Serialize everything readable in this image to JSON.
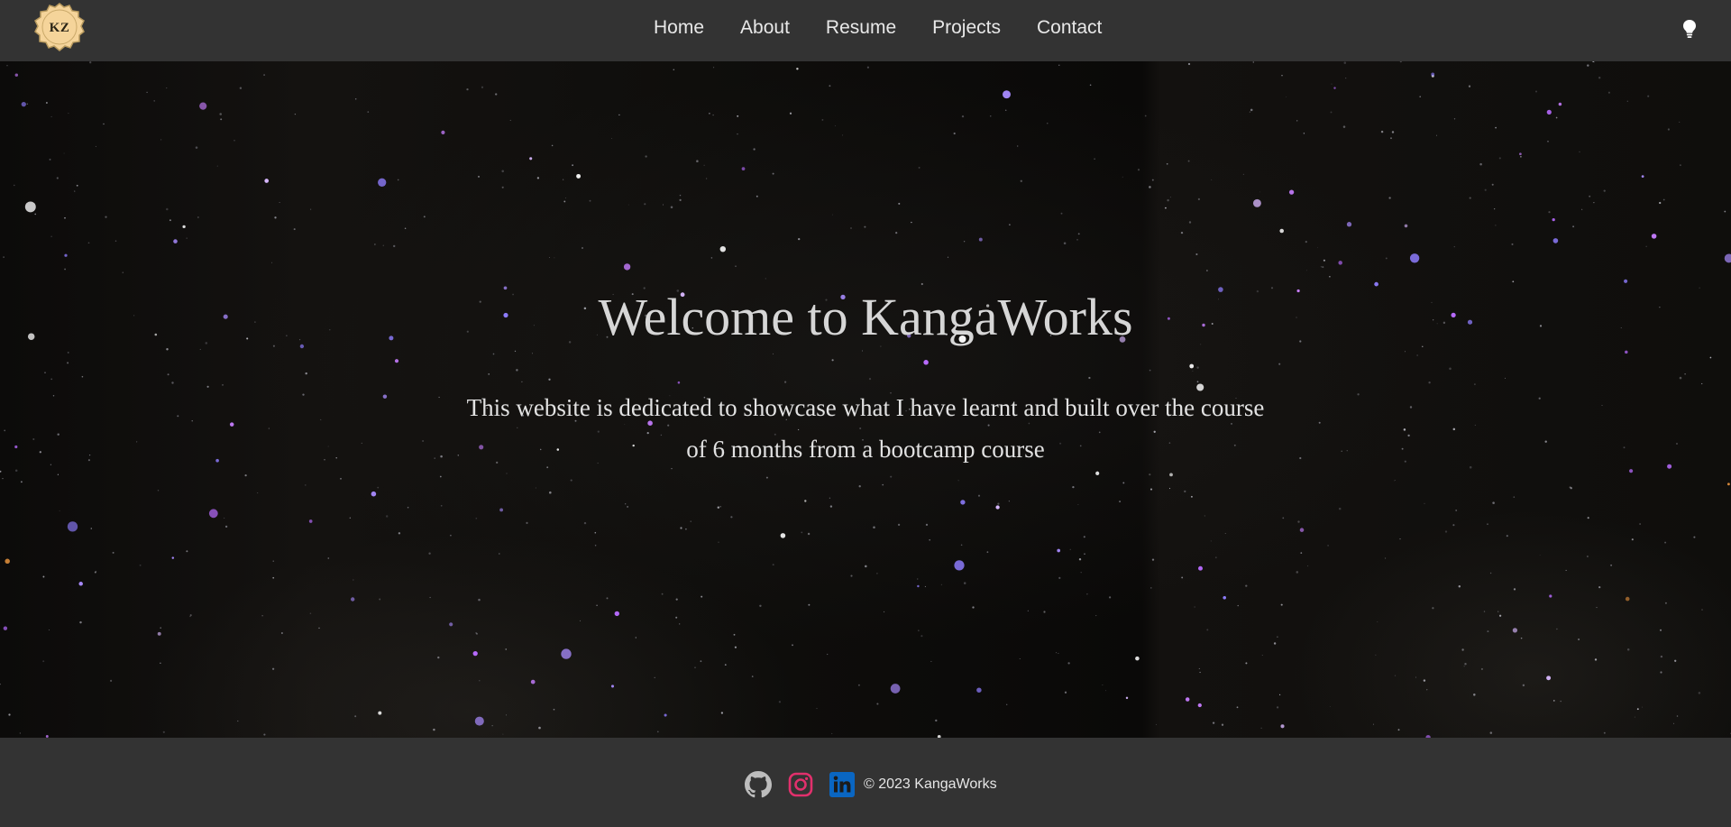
{
  "brand": {
    "logo_text": "KZ",
    "logo_color": "#f5d49a"
  },
  "nav": {
    "items": [
      {
        "label": "Home"
      },
      {
        "label": "About"
      },
      {
        "label": "Resume"
      },
      {
        "label": "Projects"
      },
      {
        "label": "Contact"
      }
    ],
    "theme_toggle_icon": "lightbulb-icon"
  },
  "hero": {
    "title": "Welcome to KangaWorks",
    "text": "This website is dedicated to showcase what I have learnt and built over the course of 6 months from a bootcamp course",
    "background": "night-sky-stars"
  },
  "footer": {
    "social": [
      {
        "icon": "github-icon",
        "color": "#bdbdbd"
      },
      {
        "icon": "instagram-icon",
        "color": "#e1306c"
      },
      {
        "icon": "linkedin-icon",
        "color": "#0a66c2"
      }
    ],
    "copyright": "© 2023 KangaWorks"
  },
  "colors": {
    "navbar_bg": "#333333",
    "footer_bg": "#333333",
    "hero_bg": "#0b0a09",
    "star_purple": "#c77dff"
  }
}
